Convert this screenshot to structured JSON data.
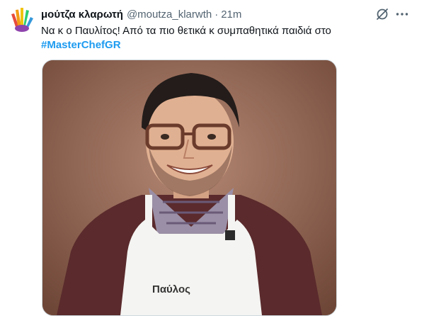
{
  "tweet": {
    "display_name": "μούτζα κλαρωτή",
    "handle": "@moutza_klarwth",
    "separator": "·",
    "time": "21m",
    "text_line1": "Να κ ο Παυλίτος! Από τα πιο θετικά κ συμπαθητικά παιδιά στο",
    "hashtag": "#MasterChefGR",
    "media": {
      "apron_label": "Παύλος"
    }
  },
  "icons": {
    "avatar": "hand-logo-icon",
    "grok": "grok-icon",
    "more": "more-options-icon"
  },
  "colors": {
    "text": "#0f1419",
    "secondary": "#536471",
    "link": "#1d9bf0"
  }
}
